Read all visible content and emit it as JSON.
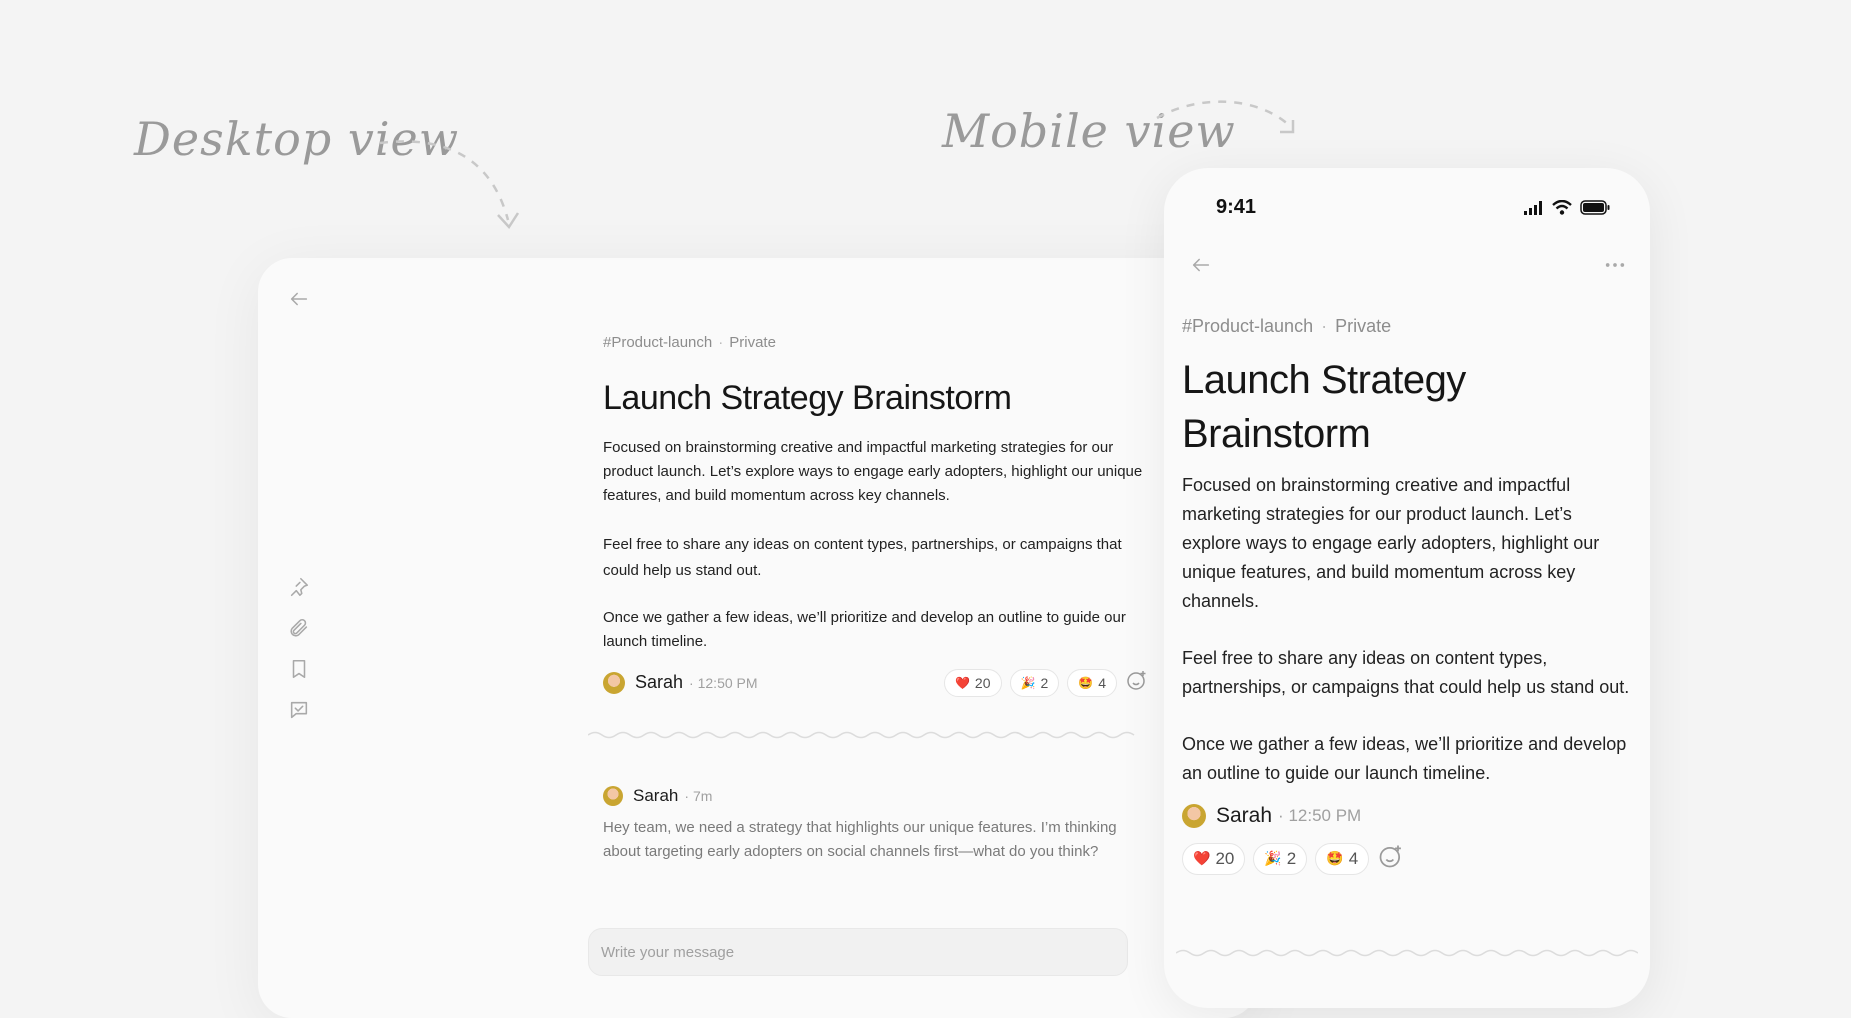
{
  "labels": {
    "desktop": "Desktop view",
    "mobile": "Mobile view"
  },
  "desktop": {
    "channel": "#Product-launch",
    "privacy": "Private",
    "title": "Launch Strategy Brainstorm",
    "paragraphs": [
      "Focused on brainstorming creative and impactful marketing strategies for our product launch. Let’s explore ways to engage early adopters, highlight our unique features, and build momentum across key channels.",
      "Feel free to share any ideas on content types, partnerships, or campaigns that could help us stand out.",
      "Once we gather a few ideas, we’ll prioritize and develop an outline to guide our launch timeline."
    ],
    "author": "Sarah",
    "time": "12:50 PM",
    "reactions": [
      {
        "emoji": "❤️",
        "count": "20"
      },
      {
        "emoji": "🎉",
        "count": "2"
      },
      {
        "emoji": "🤩",
        "count": "4"
      }
    ],
    "reply": {
      "author": "Sarah",
      "time": "7m",
      "text": "Hey team, we need a strategy that highlights our unique features. I’m thinking about targeting early adopters on social channels first—what do you think?"
    },
    "composer_placeholder": "Write your message",
    "sidebar_icons": [
      "back-arrow-icon",
      "pin-icon",
      "paperclip-icon",
      "bookmark-icon",
      "checklist-icon"
    ]
  },
  "mobile": {
    "status_time": "9:41",
    "channel": "#Product-launch",
    "privacy": "Private",
    "title": "Launch Strategy Brainstorm",
    "paragraphs": [
      "Focused on brainstorming creative and impactful marketing strategies for our product launch. Let’s explore ways to engage early adopters, highlight our unique features, and build momentum across key channels.",
      "Feel free to share any ideas on content types, partnerships, or campaigns that could help us stand out.",
      "Once we gather a few ideas, we’ll prioritize and develop an outline to guide our launch timeline."
    ],
    "author": "Sarah",
    "time": "12:50 PM",
    "reactions": [
      {
        "emoji": "❤️",
        "count": "20"
      },
      {
        "emoji": "🎉",
        "count": "2"
      },
      {
        "emoji": "🤩",
        "count": "4"
      }
    ]
  }
}
